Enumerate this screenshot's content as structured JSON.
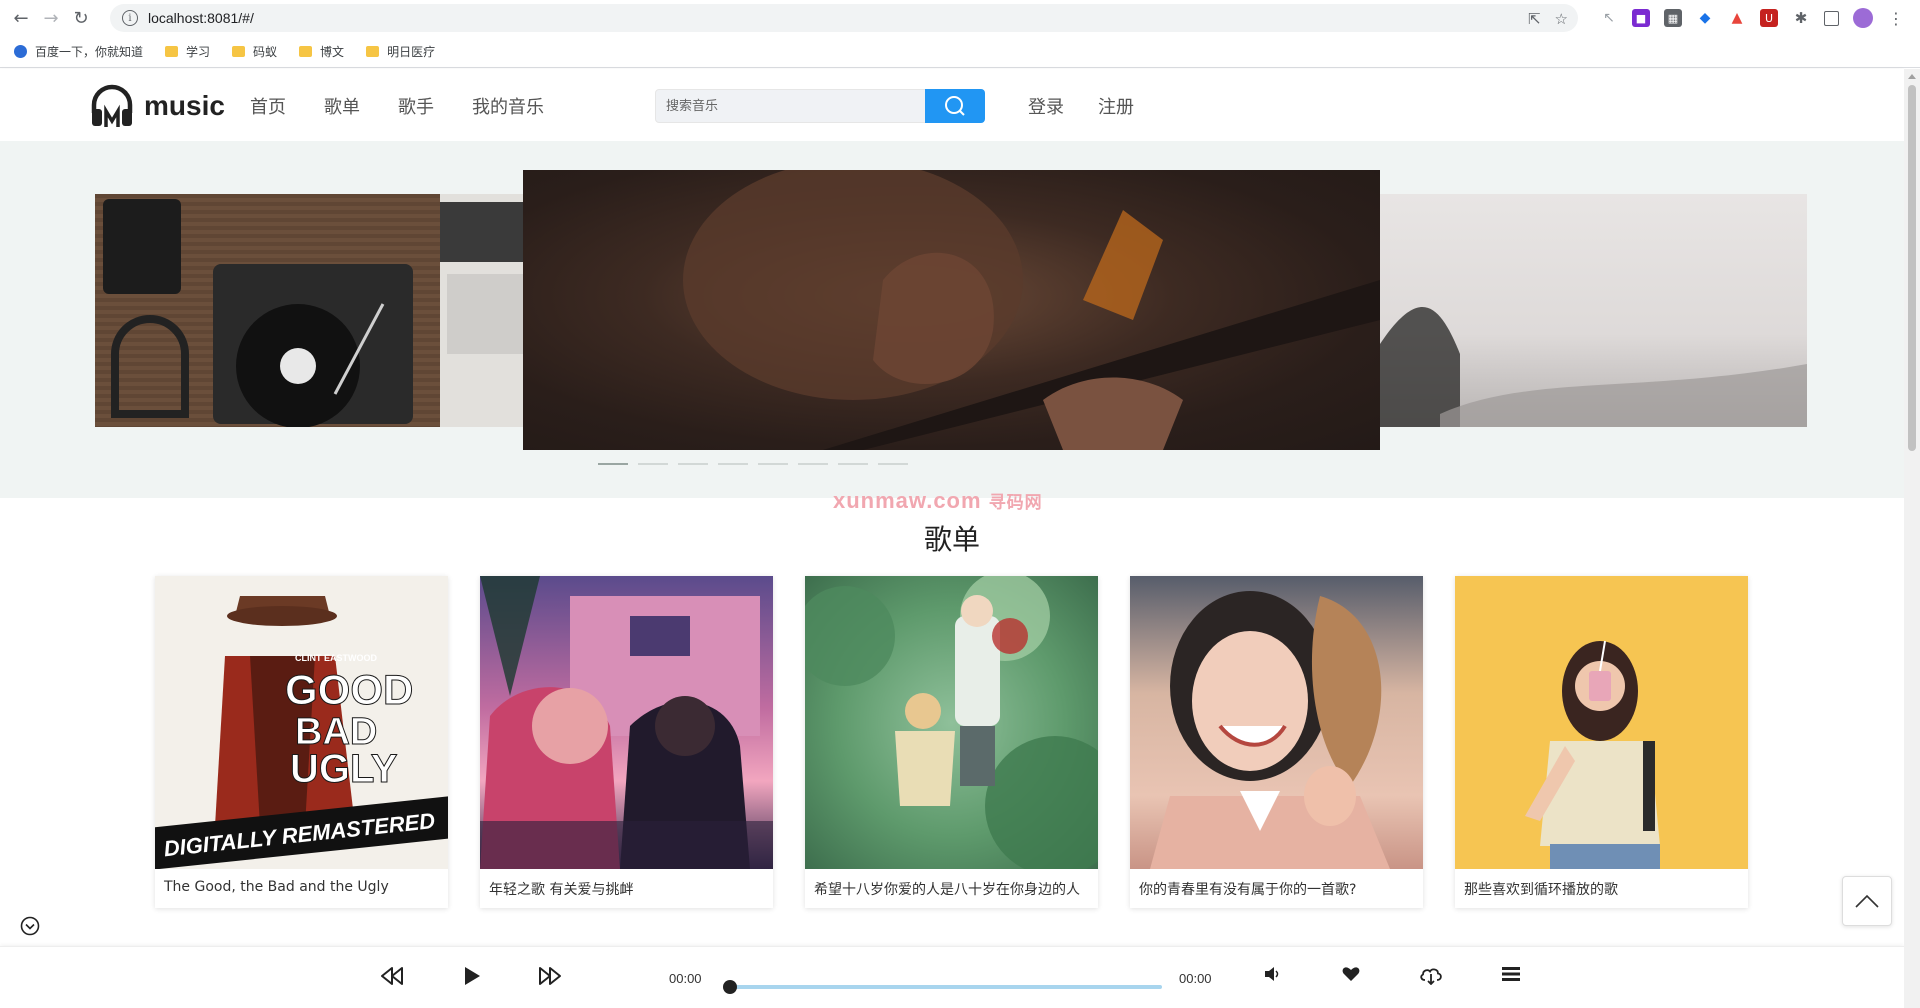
{
  "browser": {
    "url": "localhost:8081/#/",
    "bookmarks": [
      "百度一下，你就知道",
      "学习",
      "码蚁",
      "博文",
      "明日医疗"
    ]
  },
  "site": {
    "logo_text": "music",
    "nav": [
      "首页",
      "歌单",
      "歌手",
      "我的音乐"
    ],
    "search_placeholder": "搜索音乐",
    "login": "登录",
    "register": "注册"
  },
  "watermark": {
    "text": "xunmaw.com",
    "cn": "寻码网"
  },
  "carousel": {
    "dot_count": 8,
    "active_index": 0
  },
  "section": {
    "title": "歌单",
    "playlists": [
      {
        "title": "The Good, the Bad and the Ugly",
        "cover_text_top": "GOOD",
        "cover_text_mid": "BAD",
        "cover_text_bot": "UGLY",
        "cover_banner": "DIGITALLY REMASTERED",
        "cover_credit": "CLINT EASTWOOD"
      },
      {
        "title": "年轻之歌 有关爱与挑衅"
      },
      {
        "title": "希望十八岁你爱的人是八十岁在你身边的人"
      },
      {
        "title": "你的青春里有没有属于你的一首歌?"
      },
      {
        "title": "那些喜欢到循环播放的歌"
      }
    ]
  },
  "player": {
    "current_time": "00:00",
    "total_time": "00:00",
    "progress": 0
  },
  "colors": {
    "accent": "#2196f3",
    "progress_track": "#a8d5ee",
    "watermark": "#f1a7b0"
  }
}
